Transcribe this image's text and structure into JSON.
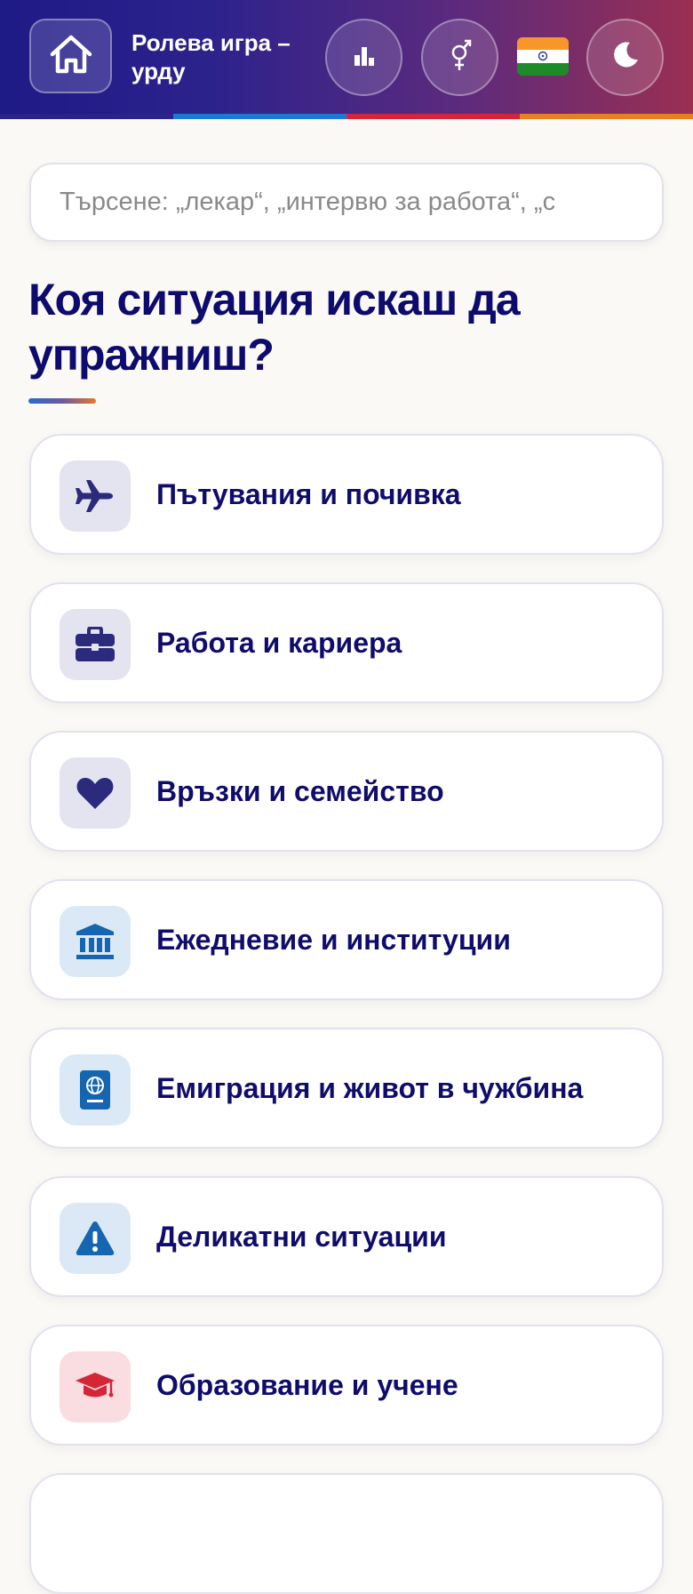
{
  "header": {
    "title": "Ролева игра – урду",
    "home_icon": "home-icon",
    "stats_icon": "bar-chart-icon",
    "gender_icon": "gender-icon",
    "flag": "india-flag",
    "theme_icon": "moon-icon"
  },
  "search": {
    "placeholder": "Търсене: „лекар“, „интервю за работа“, „с"
  },
  "heading": "Коя ситуация искаш да упражниш?",
  "categories": [
    {
      "label": "Пътувания и почивка",
      "icon": "airplane-icon"
    },
    {
      "label": "Работа и кариера",
      "icon": "briefcase-icon"
    },
    {
      "label": "Връзки и семейство",
      "icon": "heart-icon"
    },
    {
      "label": "Ежедневие и институции",
      "icon": "institution-icon"
    },
    {
      "label": "Емиграция и живот в чужбина",
      "icon": "passport-icon"
    },
    {
      "label": "Деликатни ситуации",
      "icon": "warning-icon"
    },
    {
      "label": "Образование и учене",
      "icon": "graduation-cap-icon"
    }
  ],
  "colors": {
    "brand_dark": "#0d0b6e",
    "stripe": [
      "#1f1c86",
      "#1a7bd6",
      "#d8243a",
      "#e8801e"
    ],
    "icon_bg_purple": "#e4e3f0",
    "icon_bg_blue": "#dbe9f6",
    "icon_bg_red": "#f9dde1"
  }
}
